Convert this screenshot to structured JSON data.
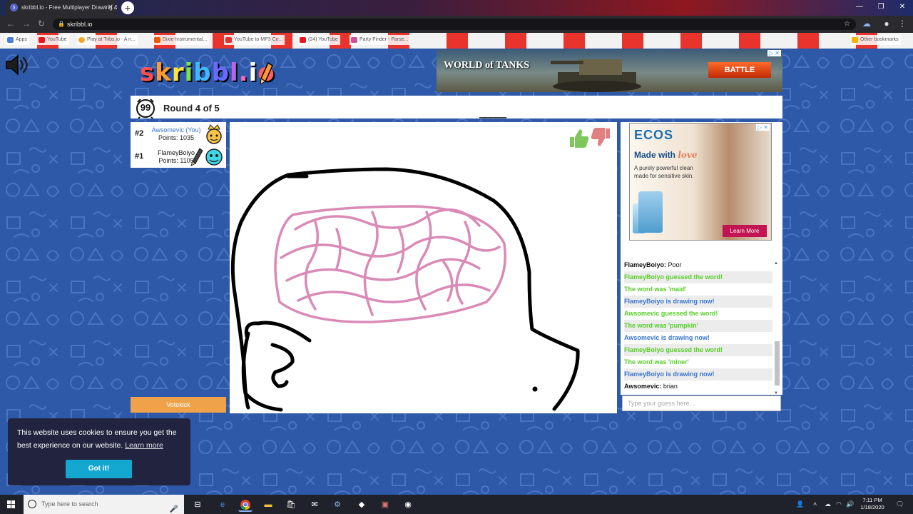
{
  "browser": {
    "tab_title": "skribbl.io - Free Multiplayer Drawing & Guessing Game",
    "tab_favicon": "skribbl-favicon",
    "url": "skribbl.io",
    "bookmarks": [
      "Apps",
      "YouTube",
      "Play at Tribs.io - A n...",
      "Dixie-Instrumental...",
      "YouTube to MP3 Co...",
      "(24) YouTube",
      "Party Finder - Parse..."
    ],
    "other_bookmarks": "Other bookmarks"
  },
  "game": {
    "logo": "skribbl.io",
    "logo_letters": [
      "s",
      "k",
      "r",
      "i",
      "b",
      "b",
      "l",
      ".",
      "i",
      "o"
    ],
    "timer": "99",
    "round_label": "Round 4 of 5",
    "word_hint": "_____",
    "votekick_label": "Votekick",
    "players": [
      {
        "rank": "#2",
        "name": "Awsomevic (You)",
        "points": "Points: 1035",
        "name_color": "#3975ce"
      },
      {
        "rank": "#1",
        "name": "FlameyBoiyo",
        "points": "Points: 1105",
        "name_color": "#111111"
      }
    ]
  },
  "ads": {
    "top": {
      "brand": "WORLD of TANKS",
      "cta": "BATTLE",
      "adchoices": "▷ ✕"
    },
    "side": {
      "brand": "ECOS",
      "headline_a": "Made with ",
      "headline_b": "love",
      "subline": "A purely powerful clean made for sensitive skin.",
      "cta": "Learn More",
      "adchoices": "▷ ✕"
    }
  },
  "chat": {
    "messages": [
      {
        "author": "FlameyBoiyo: ",
        "text": "Poor",
        "kind": "dark"
      },
      {
        "author": "",
        "text": "FlameyBoiyo guessed the word!",
        "kind": "green"
      },
      {
        "author": "",
        "text": "The word was 'maid'",
        "kind": "green"
      },
      {
        "author": "",
        "text": "FlameyBoiyo is drawing now!",
        "kind": "blue"
      },
      {
        "author": "",
        "text": "Awsomevic guessed the word!",
        "kind": "green"
      },
      {
        "author": "",
        "text": "The word was 'pumpkin'",
        "kind": "green"
      },
      {
        "author": "",
        "text": "Awsomevic is drawing now!",
        "kind": "blue"
      },
      {
        "author": "",
        "text": "FlameyBoiyo guessed the word!",
        "kind": "green"
      },
      {
        "author": "",
        "text": "The word was 'miner'",
        "kind": "green"
      },
      {
        "author": "",
        "text": "FlameyBoiyo is drawing now!",
        "kind": "blue"
      },
      {
        "author": "Awsomevic: ",
        "text": "brian",
        "kind": "dark"
      }
    ],
    "input_placeholder": "Type your guess here..."
  },
  "cookie": {
    "text": "This website uses cookies to ensure you get the best experience on our website. ",
    "learn_more": "Learn more",
    "accept": "Got it!"
  },
  "taskbar": {
    "search_placeholder": "Type here to search",
    "time": "7:11 PM",
    "date": "1/18/2020"
  },
  "colors": {
    "page_bg": "#2e58a8",
    "chat_green": "#56ce27",
    "chat_blue": "#3975ce",
    "brain_pink": "#d98ab6",
    "votekick": "#f0a24a",
    "cookie_button": "#14a7d0"
  }
}
